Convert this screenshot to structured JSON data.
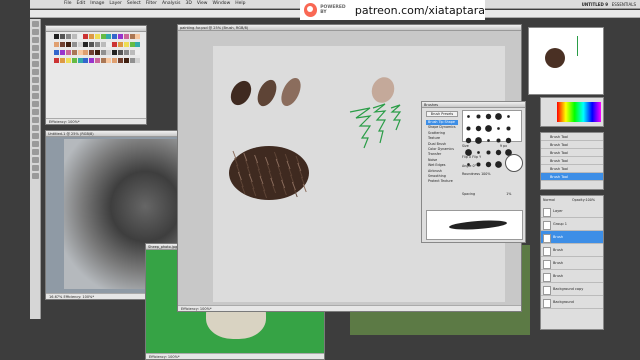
{
  "app": {
    "menu": [
      "File",
      "Edit",
      "Image",
      "Layer",
      "Select",
      "Filter",
      "Analysis",
      "3D",
      "View",
      "Window",
      "Help"
    ],
    "workspace": "UNTITLED 9",
    "essentials": "ESSENTIALS"
  },
  "banner": {
    "powered": "POWERED BY",
    "url": "patreon.com/xiataptara"
  },
  "canvas": {
    "title": "painting-fur.psd @ 25% (Brush, RGB/8)",
    "status": "Efficiency: 100%*"
  },
  "left_doc": {
    "title": "Untitled-1 @ 25% (RGB/8)",
    "zoom": "16.67%",
    "status": "Efficiency: 100%*"
  },
  "sheep_doc": {
    "title": "Sheep_photo.jpg",
    "status": "Efficiency: 100%*"
  },
  "swatch_doc": {
    "status": "Efficiency: 100%*"
  },
  "brush_panel": {
    "title": "Brushes",
    "preset_button": "Brush Presets",
    "options": [
      "Brush Tip Shape",
      "Shape Dynamics",
      "Scattering",
      "Texture",
      "Dual Brush",
      "Color Dynamics",
      "Transfer",
      "Noise",
      "Wet Edges",
      "Airbrush",
      "Smoothing",
      "Protect Texture"
    ],
    "selected": 0,
    "size_label": "Size",
    "size_value": "9 px",
    "flip_x": "Flip X",
    "flip_y": "Flip Y",
    "angle_label": "Angle",
    "angle": "0°",
    "roundness_label": "Roundness",
    "roundness": "100%",
    "spacing_label": "Spacing",
    "spacing": "1%"
  },
  "layers": {
    "blend": "Normal",
    "opacity_label": "Opacity:",
    "opacity": "100%",
    "fill_label": "Fill:",
    "fill": "100%",
    "items": [
      "Layer",
      "Group 1",
      "Brush",
      "Brush",
      "Brush",
      "Brush",
      "Background copy",
      "Background"
    ],
    "selected": 2
  },
  "brush_list": {
    "items": [
      "Brush Tool",
      "Brush Tool",
      "Brush Tool",
      "Brush Tool",
      "Brush Tool",
      "Brush Tool"
    ],
    "selected": 5
  },
  "colors": {
    "fur_dark": "#3f2a20",
    "fur_mid": "#5e4436",
    "fur_light": "#8b6d5d",
    "pale": "#c4a99a",
    "grass": "#2a9d47",
    "accent": "#3d8ee6"
  }
}
